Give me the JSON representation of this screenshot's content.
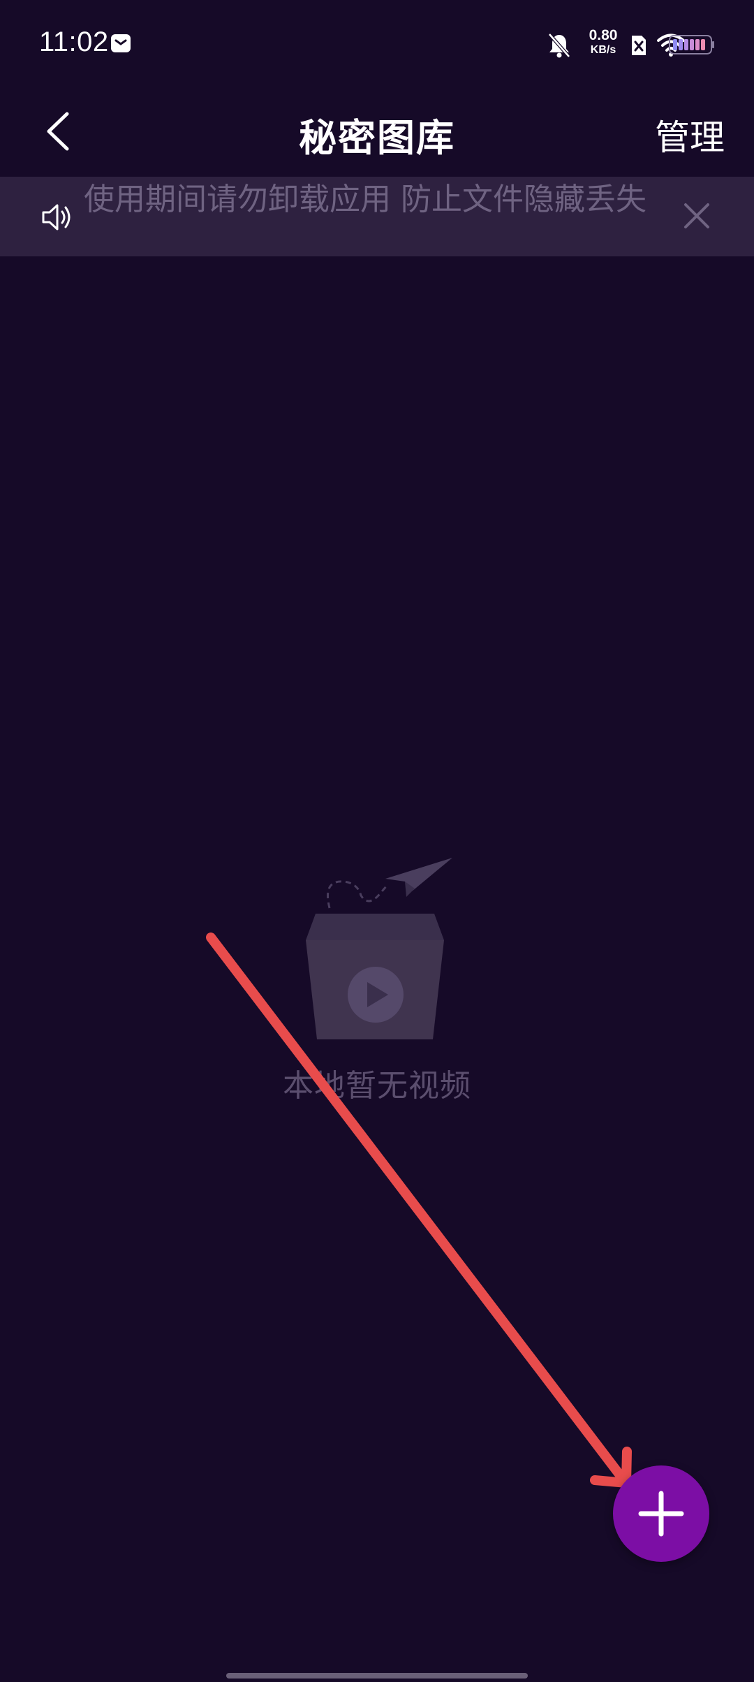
{
  "status_bar": {
    "time": "11:02",
    "net_speed_value": "0.80",
    "net_speed_unit": "KB/s",
    "icons": [
      "message-icon",
      "bell-muted-icon",
      "sim-off-icon",
      "wifi-icon",
      "battery-icon"
    ]
  },
  "nav": {
    "title": "秘密图库",
    "manage_label": "管理",
    "back_icon": "chevron-left-icon"
  },
  "notice": {
    "text": "使用期间请勿卸载应用 防止文件隐藏丢失",
    "icon": "speaker-icon",
    "close_icon": "close-icon"
  },
  "empty_state": {
    "text": "本地暂无视频",
    "icon": "empty-box-video-icon"
  },
  "fab": {
    "icon": "plus-icon"
  },
  "colors": {
    "background": "#160a28",
    "banner": "#2e2140",
    "banner_text": "#6f6382",
    "fab": "#7c0ea5",
    "annotation": "#e84c4c"
  }
}
